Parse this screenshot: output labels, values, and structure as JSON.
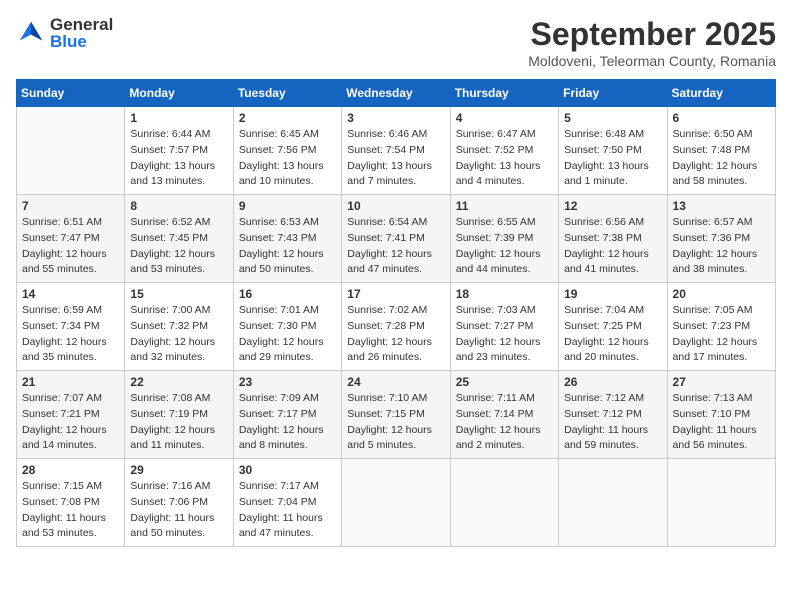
{
  "header": {
    "logo_line1": "General",
    "logo_line2": "Blue",
    "month": "September 2025",
    "location": "Moldoveni, Teleorman County, Romania"
  },
  "weekdays": [
    "Sunday",
    "Monday",
    "Tuesday",
    "Wednesday",
    "Thursday",
    "Friday",
    "Saturday"
  ],
  "weeks": [
    [
      {
        "day": "",
        "info": ""
      },
      {
        "day": "1",
        "info": "Sunrise: 6:44 AM\nSunset: 7:57 PM\nDaylight: 13 hours\nand 13 minutes."
      },
      {
        "day": "2",
        "info": "Sunrise: 6:45 AM\nSunset: 7:56 PM\nDaylight: 13 hours\nand 10 minutes."
      },
      {
        "day": "3",
        "info": "Sunrise: 6:46 AM\nSunset: 7:54 PM\nDaylight: 13 hours\nand 7 minutes."
      },
      {
        "day": "4",
        "info": "Sunrise: 6:47 AM\nSunset: 7:52 PM\nDaylight: 13 hours\nand 4 minutes."
      },
      {
        "day": "5",
        "info": "Sunrise: 6:48 AM\nSunset: 7:50 PM\nDaylight: 13 hours\nand 1 minute."
      },
      {
        "day": "6",
        "info": "Sunrise: 6:50 AM\nSunset: 7:48 PM\nDaylight: 12 hours\nand 58 minutes."
      }
    ],
    [
      {
        "day": "7",
        "info": "Sunrise: 6:51 AM\nSunset: 7:47 PM\nDaylight: 12 hours\nand 55 minutes."
      },
      {
        "day": "8",
        "info": "Sunrise: 6:52 AM\nSunset: 7:45 PM\nDaylight: 12 hours\nand 53 minutes."
      },
      {
        "day": "9",
        "info": "Sunrise: 6:53 AM\nSunset: 7:43 PM\nDaylight: 12 hours\nand 50 minutes."
      },
      {
        "day": "10",
        "info": "Sunrise: 6:54 AM\nSunset: 7:41 PM\nDaylight: 12 hours\nand 47 minutes."
      },
      {
        "day": "11",
        "info": "Sunrise: 6:55 AM\nSunset: 7:39 PM\nDaylight: 12 hours\nand 44 minutes."
      },
      {
        "day": "12",
        "info": "Sunrise: 6:56 AM\nSunset: 7:38 PM\nDaylight: 12 hours\nand 41 minutes."
      },
      {
        "day": "13",
        "info": "Sunrise: 6:57 AM\nSunset: 7:36 PM\nDaylight: 12 hours\nand 38 minutes."
      }
    ],
    [
      {
        "day": "14",
        "info": "Sunrise: 6:59 AM\nSunset: 7:34 PM\nDaylight: 12 hours\nand 35 minutes."
      },
      {
        "day": "15",
        "info": "Sunrise: 7:00 AM\nSunset: 7:32 PM\nDaylight: 12 hours\nand 32 minutes."
      },
      {
        "day": "16",
        "info": "Sunrise: 7:01 AM\nSunset: 7:30 PM\nDaylight: 12 hours\nand 29 minutes."
      },
      {
        "day": "17",
        "info": "Sunrise: 7:02 AM\nSunset: 7:28 PM\nDaylight: 12 hours\nand 26 minutes."
      },
      {
        "day": "18",
        "info": "Sunrise: 7:03 AM\nSunset: 7:27 PM\nDaylight: 12 hours\nand 23 minutes."
      },
      {
        "day": "19",
        "info": "Sunrise: 7:04 AM\nSunset: 7:25 PM\nDaylight: 12 hours\nand 20 minutes."
      },
      {
        "day": "20",
        "info": "Sunrise: 7:05 AM\nSunset: 7:23 PM\nDaylight: 12 hours\nand 17 minutes."
      }
    ],
    [
      {
        "day": "21",
        "info": "Sunrise: 7:07 AM\nSunset: 7:21 PM\nDaylight: 12 hours\nand 14 minutes."
      },
      {
        "day": "22",
        "info": "Sunrise: 7:08 AM\nSunset: 7:19 PM\nDaylight: 12 hours\nand 11 minutes."
      },
      {
        "day": "23",
        "info": "Sunrise: 7:09 AM\nSunset: 7:17 PM\nDaylight: 12 hours\nand 8 minutes."
      },
      {
        "day": "24",
        "info": "Sunrise: 7:10 AM\nSunset: 7:15 PM\nDaylight: 12 hours\nand 5 minutes."
      },
      {
        "day": "25",
        "info": "Sunrise: 7:11 AM\nSunset: 7:14 PM\nDaylight: 12 hours\nand 2 minutes."
      },
      {
        "day": "26",
        "info": "Sunrise: 7:12 AM\nSunset: 7:12 PM\nDaylight: 11 hours\nand 59 minutes."
      },
      {
        "day": "27",
        "info": "Sunrise: 7:13 AM\nSunset: 7:10 PM\nDaylight: 11 hours\nand 56 minutes."
      }
    ],
    [
      {
        "day": "28",
        "info": "Sunrise: 7:15 AM\nSunset: 7:08 PM\nDaylight: 11 hours\nand 53 minutes."
      },
      {
        "day": "29",
        "info": "Sunrise: 7:16 AM\nSunset: 7:06 PM\nDaylight: 11 hours\nand 50 minutes."
      },
      {
        "day": "30",
        "info": "Sunrise: 7:17 AM\nSunset: 7:04 PM\nDaylight: 11 hours\nand 47 minutes."
      },
      {
        "day": "",
        "info": ""
      },
      {
        "day": "",
        "info": ""
      },
      {
        "day": "",
        "info": ""
      },
      {
        "day": "",
        "info": ""
      }
    ]
  ]
}
